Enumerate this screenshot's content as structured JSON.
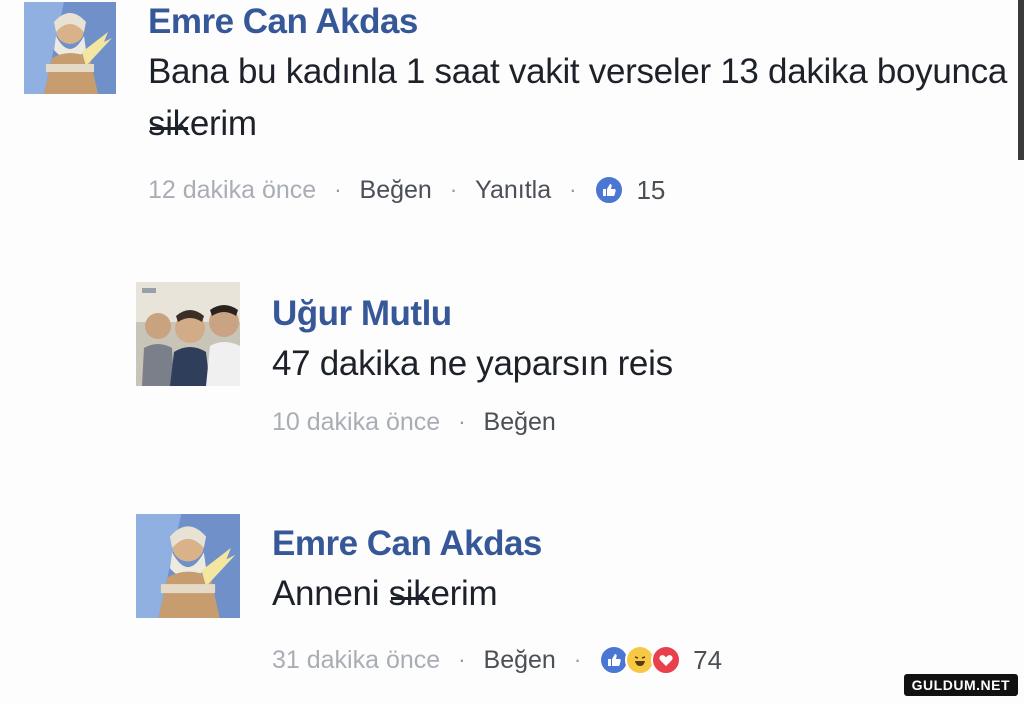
{
  "colors": {
    "author": "#365899",
    "text": "#1d2129",
    "meta": "#90949c",
    "like": "#4a76d4",
    "haha": "#f7c844",
    "love": "#e8414d"
  },
  "comments": [
    {
      "author": "Emre Can Akdas",
      "text_before": "Bana bu kadınla 1 saat vakit verseler 13 dakika boyunca ",
      "text_strike": "sik",
      "text_after": "erim",
      "time": "12 dakika önce",
      "like_label": "Beğen",
      "reply_label": "Yanıtla",
      "reactions": [
        "like-icon"
      ],
      "reaction_count": "15",
      "avatar": "zeus-avatar"
    },
    {
      "author": "Uğur Mutlu",
      "text": "47 dakika ne yaparsın reis",
      "time": "10 dakika önce",
      "like_label": "Beğen",
      "avatar": "group-photo-avatar"
    },
    {
      "author": "Emre Can Akdas",
      "text_before": "Anneni ",
      "text_strike": "sik",
      "text_after": "erim",
      "time": "31 dakika önce",
      "like_label": "Beğen",
      "reactions": [
        "like-icon",
        "haha-icon",
        "love-icon"
      ],
      "reaction_count": "74",
      "avatar": "zeus-avatar"
    }
  ],
  "watermark": "GULDUM.NET"
}
